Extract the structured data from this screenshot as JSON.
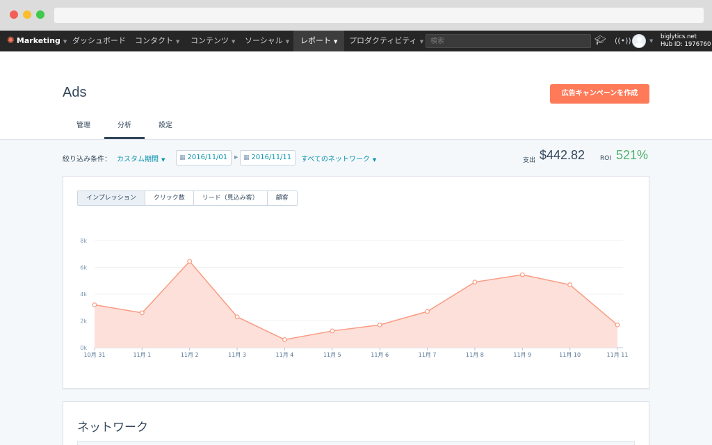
{
  "nav": {
    "brand": "Marketing",
    "items": [
      {
        "label": "ダッシュボード"
      },
      {
        "label": "コンタクト"
      },
      {
        "label": "コンテンツ"
      },
      {
        "label": "ソーシャル"
      },
      {
        "label": "レポート"
      },
      {
        "label": "プロダクティビティ"
      }
    ],
    "search_placeholder": "検索",
    "account_domain": "biglytics.net",
    "account_hub": "Hub ID: 1976760"
  },
  "page": {
    "title": "Ads",
    "create_button": "広告キャンペーンを作成",
    "tabs": [
      {
        "label": "管理"
      },
      {
        "label": "分析"
      },
      {
        "label": "設定"
      }
    ]
  },
  "filters": {
    "label": "絞り込み条件：",
    "range_type": "カスタム期間",
    "start_date": "2016/11/01",
    "end_date": "2016/11/11",
    "network": "すべてのネットワーク",
    "spend_label": "支出",
    "spend_value": "$442.82",
    "roi_label": "ROI",
    "roi_value": "521%"
  },
  "metric_tabs": [
    {
      "label": "インプレッション"
    },
    {
      "label": "クリック数"
    },
    {
      "label": "リード（見込み客）"
    },
    {
      "label": "顧客"
    }
  ],
  "chart_data": {
    "type": "area",
    "categories": [
      "10月 31",
      "11月 1",
      "11月 2",
      "11月 3",
      "11月 4",
      "11月 5",
      "11月 6",
      "11月 7",
      "11月 8",
      "11月 9",
      "11月 10",
      "11月 11"
    ],
    "values": [
      3200,
      2600,
      6450,
      2300,
      600,
      1250,
      1700,
      2700,
      4900,
      5450,
      4700,
      1700
    ],
    "yticks": [
      "0k",
      "2k",
      "4k",
      "6k",
      "8k"
    ],
    "ylim": [
      0,
      8000
    ],
    "grid": true,
    "color": "#f99b82",
    "fill": "#fde0d9"
  },
  "network_section": {
    "title": "ネットワーク"
  },
  "colors": {
    "accent": "#ff7a59",
    "link": "#0091ae",
    "roi": "#4fb06d",
    "nav_bg": "#262626"
  }
}
